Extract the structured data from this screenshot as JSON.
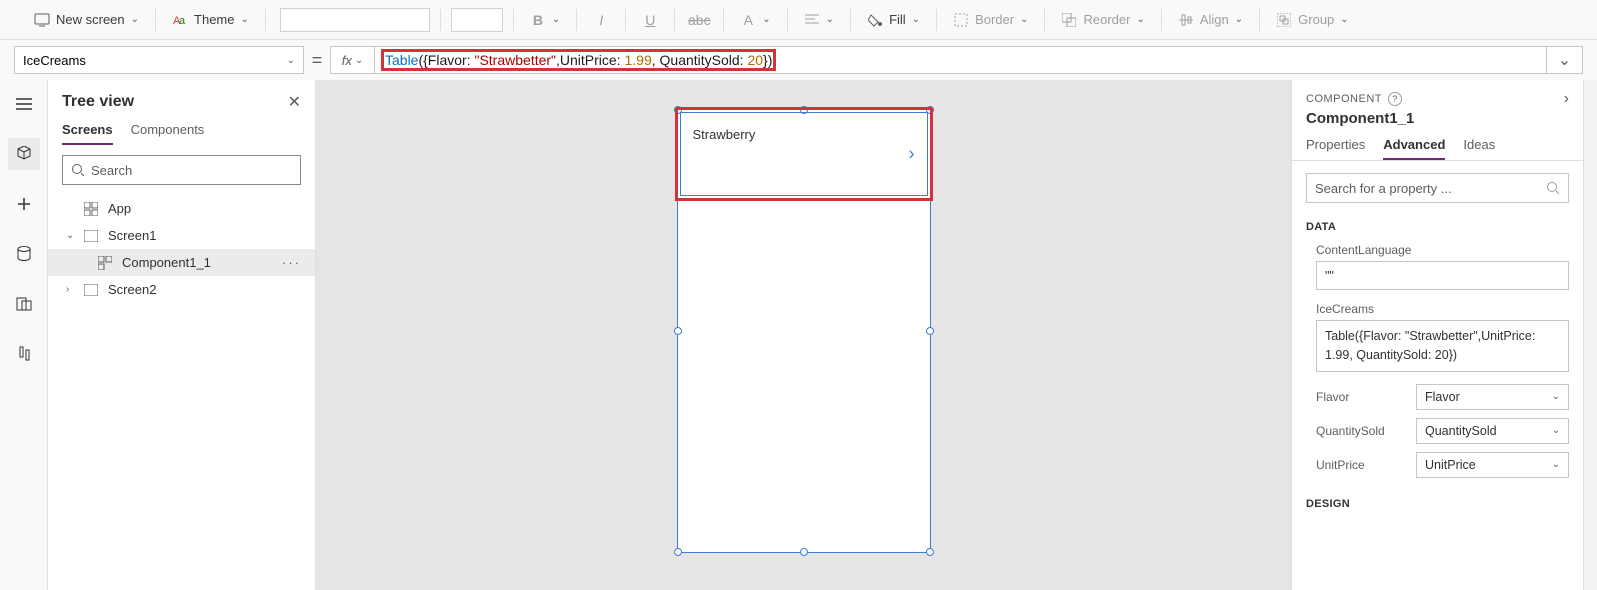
{
  "toolbar": {
    "new_screen": "New screen",
    "theme": "Theme",
    "fill": "Fill",
    "border": "Border",
    "reorder": "Reorder",
    "align": "Align",
    "group": "Group"
  },
  "formula": {
    "property": "IceCreams",
    "fx": "fx",
    "tokens": {
      "table": "Table",
      "p1": "({Flavor: ",
      "str": "\"Strawbetter\"",
      "p2": ",UnitPrice: ",
      "n1": "1.99",
      "p3": ", QuantitySold: ",
      "n2": "20",
      "p4": "})"
    }
  },
  "tree": {
    "title": "Tree view",
    "tabs": {
      "screens": "Screens",
      "components": "Components"
    },
    "search_placeholder": "Search",
    "items": {
      "app": "App",
      "screen1": "Screen1",
      "component": "Component1_1",
      "screen2": "Screen2"
    }
  },
  "canvas": {
    "item_text": "Strawberry"
  },
  "right": {
    "section": "COMPONENT",
    "name": "Component1_1",
    "tabs": {
      "properties": "Properties",
      "advanced": "Advanced",
      "ideas": "Ideas"
    },
    "search_placeholder": "Search for a property ...",
    "data_label": "DATA",
    "design_label": "DESIGN",
    "fields": {
      "content_language_label": "ContentLanguage",
      "content_language_value": "\"\"",
      "icecreams_label": "IceCreams",
      "icecreams_value": "Table({Flavor: \"Strawbetter\",UnitPrice: 1.99, QuantitySold: 20})",
      "flavor_label": "Flavor",
      "flavor_value": "Flavor",
      "qty_label": "QuantitySold",
      "qty_value": "QuantitySold",
      "price_label": "UnitPrice",
      "price_value": "UnitPrice"
    }
  }
}
